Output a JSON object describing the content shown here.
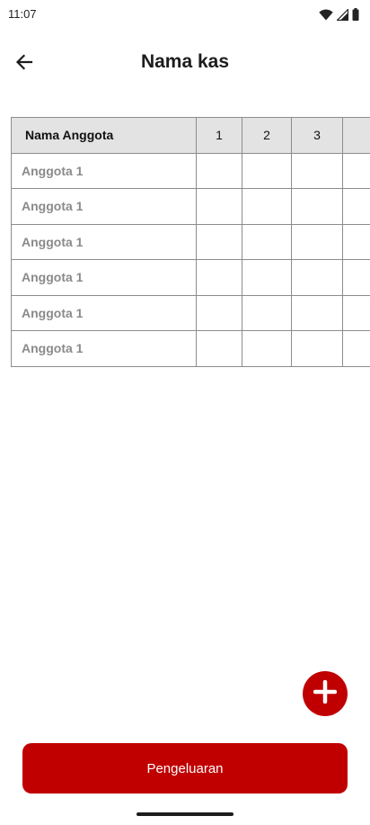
{
  "status_bar": {
    "time": "11:07",
    "icons": [
      "wifi-icon",
      "signal-icon",
      "battery-icon"
    ]
  },
  "app_bar": {
    "back_icon": "arrow-left-icon",
    "title": "Nama kas"
  },
  "table": {
    "headers": [
      "Nama Anggota",
      "1",
      "2",
      "3",
      ""
    ],
    "rows": [
      {
        "name": "Anggota 1",
        "values": [
          "",
          "",
          "",
          ""
        ]
      },
      {
        "name": "Anggota 1",
        "values": [
          "",
          "",
          "",
          ""
        ]
      },
      {
        "name": "Anggota 1",
        "values": [
          "",
          "",
          "",
          ""
        ]
      },
      {
        "name": "Anggota 1",
        "values": [
          "",
          "",
          "",
          ""
        ]
      },
      {
        "name": "Anggota 1",
        "values": [
          "",
          "",
          "",
          ""
        ]
      },
      {
        "name": "Anggota 1",
        "values": [
          "",
          "",
          "",
          ""
        ]
      }
    ]
  },
  "fab": {
    "icon": "plus-icon"
  },
  "primary_action": {
    "label": "Pengeluaran"
  },
  "colors": {
    "accent": "#c00000",
    "header_bg": "#e3e3e3",
    "border": "#8c8c8c",
    "muted_text": "#8a8a8a"
  }
}
